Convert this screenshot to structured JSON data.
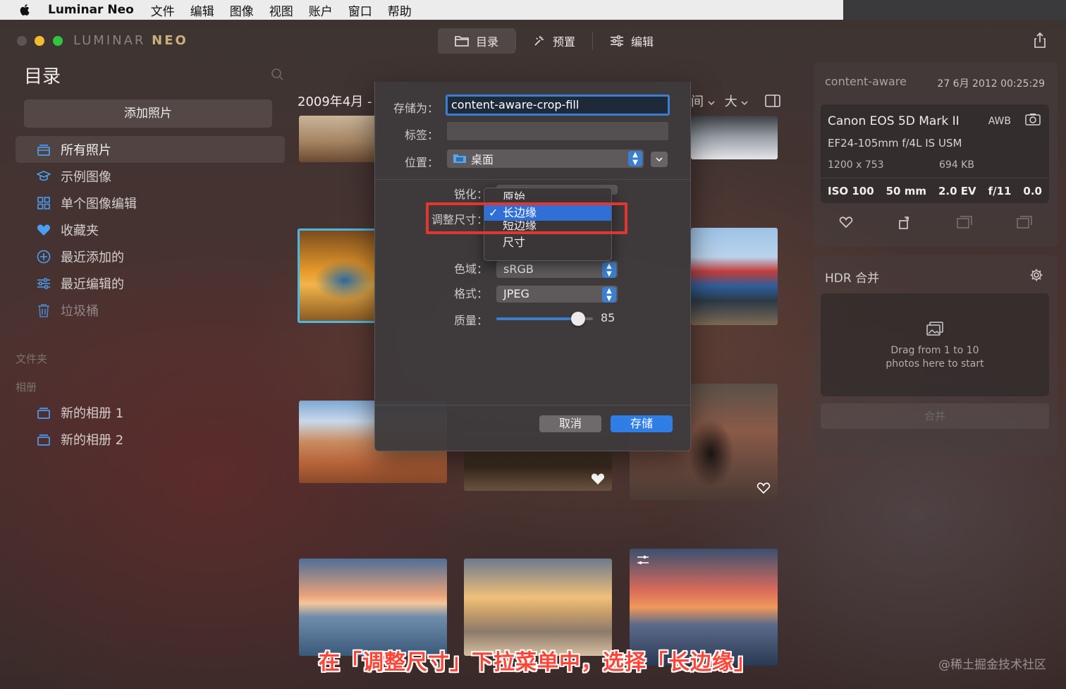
{
  "menubar": {
    "app": "Luminar Neo",
    "items": [
      "文件",
      "编辑",
      "图像",
      "视图",
      "账户",
      "窗口",
      "帮助"
    ]
  },
  "brand": {
    "first": "LUMINAR",
    "second": "NEO"
  },
  "topnav": {
    "tabs": [
      {
        "label": "目录",
        "icon": "folder-icon",
        "active": true
      },
      {
        "label": "预置",
        "icon": "sparkle-icon",
        "active": false
      },
      {
        "label": "编辑",
        "icon": "sliders-icon",
        "active": false
      }
    ]
  },
  "sidebar": {
    "title": "目录",
    "add_button": "添加照片",
    "items": [
      {
        "label": "所有照片",
        "icon": "photos-stack-icon",
        "active": true
      },
      {
        "label": "示例图像",
        "icon": "graduation-cap-icon"
      },
      {
        "label": "单个图像编辑",
        "icon": "grid-icon"
      },
      {
        "label": "收藏夹",
        "icon": "heart-icon"
      },
      {
        "label": "最近添加的",
        "icon": "plus-circle-icon"
      },
      {
        "label": "最近编辑的",
        "icon": "sliders-icon"
      },
      {
        "label": "垃圾桶",
        "icon": "trash-icon"
      }
    ],
    "folders_label": "文件夹",
    "albums_label": "相册",
    "albums": [
      {
        "label": "新的相册 1",
        "icon": "album-icon"
      },
      {
        "label": "新的相册 2",
        "icon": "album-icon"
      }
    ]
  },
  "gallery": {
    "month": "2009年4月 -",
    "sort_label": "间",
    "size_label": "大"
  },
  "info": {
    "filename": "content-aware",
    "date": "27 6月 2012 00:25:29",
    "camera": "Canon EOS 5D Mark II",
    "wb": "AWB",
    "lens": "EF24-105mm f/4L IS USM",
    "dimensions": "1200 x 753",
    "filesize": "694 KB",
    "exif": [
      "ISO 100",
      "50 mm",
      "2.0 EV",
      "f/11",
      "0.0"
    ]
  },
  "hdr": {
    "title": "HDR 合并",
    "drop_line1": "Drag from 1 to 10",
    "drop_line2": "photos here to start",
    "merge_button": "合并"
  },
  "dialog": {
    "save_as_label": "存储为：",
    "save_as_value": "content-aware-crop-fill",
    "tags_label": "标签：",
    "location_label": "位置：",
    "location_value": "桌面",
    "sharpen_label": "锐化：",
    "resize_label": "调整尺寸：",
    "colorspace_label": "色域：",
    "colorspace_value": "sRGB",
    "format_label": "格式：",
    "format_value": "JPEG",
    "quality_label": "质量：",
    "quality_value": "85",
    "quality_fraction": 0.85,
    "cancel": "取消",
    "save": "存储"
  },
  "resize_menu": {
    "items": [
      "原始",
      "长边缘",
      "短边缘",
      "尺寸"
    ],
    "selected": "长边缘",
    "check": "✓"
  },
  "caption": "在「调整尺寸」下拉菜单中，选择「长边缘」",
  "watermark": "@稀土掘金技术社区",
  "colors": {
    "accent": "#2f7ee6",
    "highlight": "#e3362f"
  }
}
